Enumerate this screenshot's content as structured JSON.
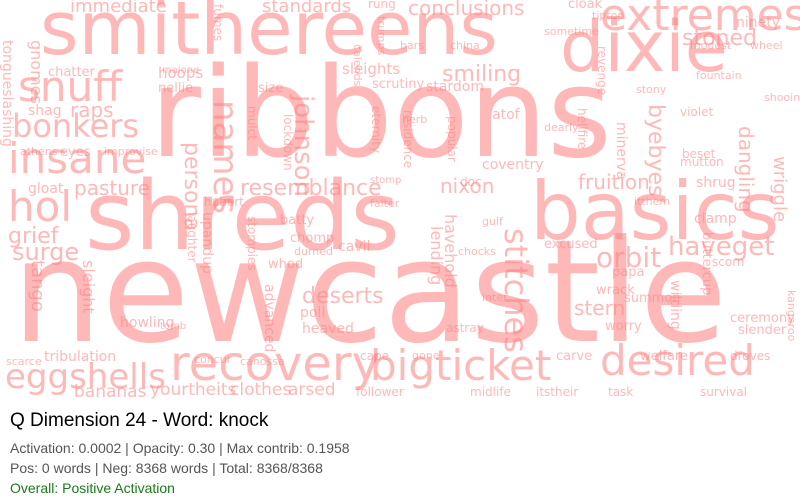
{
  "title": "Q Dimension 24 - Word: knock",
  "stats": {
    "line1": "Activation: 0.0002 | Opacity: 0.30 | Max contrib: 0.1958",
    "line2": "Pos: 0 words | Neg: 8368 words | Total: 8368/8368"
  },
  "overall": "Overall: Positive Activation",
  "colors": {
    "word": "#ff7f7f",
    "word_opacity": 0.55,
    "overall": "#1a7a1a",
    "stats": "#555555"
  },
  "cloud_words": [
    "newcastle",
    "ribbons",
    "shreds",
    "smithereens",
    "basics",
    "dixie",
    "recovery",
    "bigticket",
    "desired",
    "extremes",
    "snuff",
    "insane",
    "bonkers",
    "hol",
    "names",
    "resemblance",
    "johnson",
    "eggshells",
    "surge",
    "haveget",
    "orbit",
    "fruition",
    "stitches",
    "deserts",
    "stoned",
    "smiling",
    "conclusions",
    "standards",
    "immediate",
    "raps",
    "grief",
    "pasture",
    "persona",
    "byebyes",
    "nixon",
    "dangling",
    "wriggle",
    "stern",
    "bananas",
    "yourtheits",
    "clothes",
    "arsed",
    "follower",
    "midlife",
    "itstheir",
    "task",
    "survival",
    "welfare",
    "carve",
    "worry",
    "heaved",
    "poll",
    "cavil",
    "chomp",
    "batty",
    "whod",
    "durned",
    "advanced",
    "howling",
    "sleight",
    "tango",
    "tribulation",
    "scarce",
    "ceremony",
    "slender",
    "droves",
    "summon",
    "wrack",
    "papa",
    "shrug",
    "clamp",
    "scorn",
    "excused",
    "lending",
    "havehold",
    "chocks",
    "astray",
    "inter",
    "wilding",
    "buttercup",
    "mulct",
    "lockdown",
    "residence",
    "coventry",
    "doc",
    "atof",
    "stardom",
    "scrutiny",
    "sleights",
    "hoops",
    "nellie",
    "size",
    "shag",
    "gloat",
    "gnomes",
    "chatter",
    "tongueslashing",
    "athens",
    "eyes",
    "improvise",
    "cloak",
    "ninety",
    "violet",
    "beset",
    "mutton",
    "hellfire",
    "minerva",
    "dearly",
    "popular",
    "eternity",
    "herb",
    "stomp",
    "falter",
    "gulf",
    "hubert",
    "upandup",
    "laughter",
    "stompies",
    "tomb",
    "concur",
    "canossa",
    "cape",
    "gone",
    "kangaroo",
    "fumes",
    "malone",
    "bars",
    "china",
    "rung",
    "trumps",
    "calends",
    "sometime",
    "tiptop",
    "fountain",
    "shooin",
    "revenge",
    "itthem",
    "modest",
    "wheel",
    "stony"
  ]
}
